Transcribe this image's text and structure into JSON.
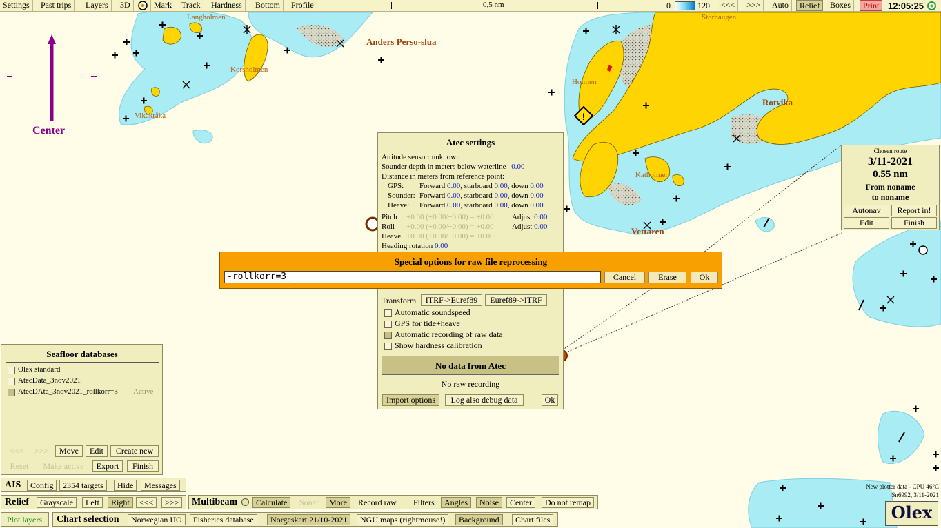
{
  "colors": {
    "land": "#ffd400",
    "shallow": "#a9ecf4",
    "deep_edge": "#7ecfe0",
    "sea": "#fffde8",
    "panel": "#f0eebe",
    "dialog": "#f8a000",
    "accent_purple": "#8a008a"
  },
  "toolbar": {
    "items": [
      {
        "label": "Settings"
      },
      {
        "label": "Past trips"
      },
      {
        "label": "Layers"
      },
      {
        "label": "3D"
      },
      {
        "label": "Mark",
        "icon": "target-icon"
      },
      {
        "label": "Track"
      },
      {
        "label": "Hardness"
      },
      {
        "label": "Bottom"
      },
      {
        "label": "Profile"
      }
    ],
    "scale_label": "0,5 nm",
    "depth_min": "0",
    "depth_max": "120",
    "right_items": [
      {
        "label": "<<<"
      },
      {
        "label": ">>>"
      },
      {
        "label": "Auto"
      },
      {
        "label": "Relief",
        "active": true
      },
      {
        "label": "Boxes"
      },
      {
        "label": "Print"
      }
    ],
    "clock": "12:05:25",
    "gps_icon": "gps-status-icon"
  },
  "map": {
    "center_label": "Center",
    "place_names": [
      {
        "text": "Langholmen",
        "big": false
      },
      {
        "text": "Anders Perso-slua",
        "big": true
      },
      {
        "text": "Korsholmen",
        "big": false
      },
      {
        "text": "Vikakråka",
        "big": false
      },
      {
        "text": "Holmen",
        "big": false
      },
      {
        "text": "Storhaugen",
        "big": false
      },
      {
        "text": "Rotvika",
        "big": true
      },
      {
        "text": "Katholmen",
        "big": false
      },
      {
        "text": "Vettaren",
        "big": true
      }
    ]
  },
  "atec": {
    "title": "Atec settings",
    "attitude": "Attitude sensor: unknown",
    "sounder_depth_label": "Sounder depth in meters below waterline",
    "sounder_depth_value": "0.00",
    "distance_label": "Distance in meters from reference point:",
    "offsets": [
      {
        "name": "GPS:",
        "forward": "0.00",
        "starboard": "0.00",
        "down": "0.00"
      },
      {
        "name": "Sounder:",
        "forward": "0.00",
        "starboard": "0.00",
        "down": "0.00"
      },
      {
        "name": "Heave:",
        "forward": "0.00",
        "starboard": "0.00",
        "down": "0.00"
      }
    ],
    "word_forward": "Forward",
    "word_starboard": "starboard",
    "word_down": "down",
    "pitch_label": "Pitch",
    "pitch_formula": "+0.00 (+0.00/+0.00) = +0.00",
    "pitch_adjust": "0.00",
    "roll_label": "Roll",
    "roll_formula": "+0.00 (+0.00/+0.00) = +0.00",
    "roll_adjust": "0.00",
    "adjust_label": "Adjust",
    "heave_label": "Heave",
    "heave_formula": "+0.00 (+0.00/+0.00) = +0.00",
    "heading_label": "Heading rotation",
    "heading_value": "0.00",
    "transform_label": "Transform",
    "transform_btn1": "ITRF->Euref89",
    "transform_btn2": "Euref89->ITRF",
    "checkboxes": [
      {
        "label": "Automatic soundspeed",
        "checked": false
      },
      {
        "label": "GPS for tide+heave",
        "checked": false
      },
      {
        "label": "Automatic recording of raw data",
        "checked": true
      },
      {
        "label": "Show hardness calibration",
        "checked": false
      }
    ],
    "status": "No data from Atec",
    "recording": "No raw recording",
    "import_btn": "Import options",
    "debug_btn": "Log also debug data",
    "ok_btn": "Ok"
  },
  "special": {
    "title": "Special options for raw file reprocessing",
    "input_value": "-rollkorr=3_",
    "cancel": "Cancel",
    "erase": "Erase",
    "ok": "Ok"
  },
  "seafloor": {
    "title": "Seafloor databases",
    "items": [
      {
        "label": "Olex standard",
        "checked": false,
        "status": ""
      },
      {
        "label": "AtecData_3nov2021",
        "checked": false,
        "status": ""
      },
      {
        "label": "AtecDAta_3nov2021_rollkorr=3",
        "checked": true,
        "status": "Active"
      }
    ],
    "prev": "<<<",
    "next": ">>>",
    "move": "Move",
    "edit": "Edit",
    "create": "Create new",
    "reset": "Reset",
    "make_active": "Make active",
    "export": "Export",
    "finish": "Finish"
  },
  "route": {
    "header": "Chosen route",
    "date": "3/11-2021",
    "distance": "0.55 nm",
    "from": "From noname",
    "to": "to noname",
    "autonav": "Autonav",
    "report": "Report in!",
    "edit": "Edit",
    "finish": "Finish"
  },
  "ais_bar": {
    "label": "AIS",
    "config": "Config",
    "targets": "2354 targets",
    "hide": "Hide",
    "messages": "Messages"
  },
  "relief_bar": {
    "label": "Relief",
    "grayscale": "Grayscale",
    "left": "Left",
    "right": "Right",
    "prev": "<<<",
    "next": ">>>"
  },
  "multibeam_bar": {
    "label": "Multibeam",
    "calculate": "Calculate",
    "sonar": "Sonar",
    "more": "More",
    "record_raw": "Record raw",
    "filters": "Filters",
    "angles": "Angles",
    "noise": "Noise",
    "center": "Center",
    "no_remap": "Do not remap"
  },
  "chart_bar": {
    "plot_layers": "Plot layers",
    "label": "Chart selection",
    "norwegian_ho": "Norwegian HO",
    "fisheries": "Fisheries database",
    "norgeskart": "Norgeskart 21/10-2021",
    "ngu": "NGU maps (rightmouse!)",
    "background": "Background",
    "chart_files": "Chart files"
  },
  "plotter": {
    "line1": "New plotter data - CPU 46°C",
    "line2": "Sn6992, 3/11-2021"
  },
  "logo": "Olex"
}
